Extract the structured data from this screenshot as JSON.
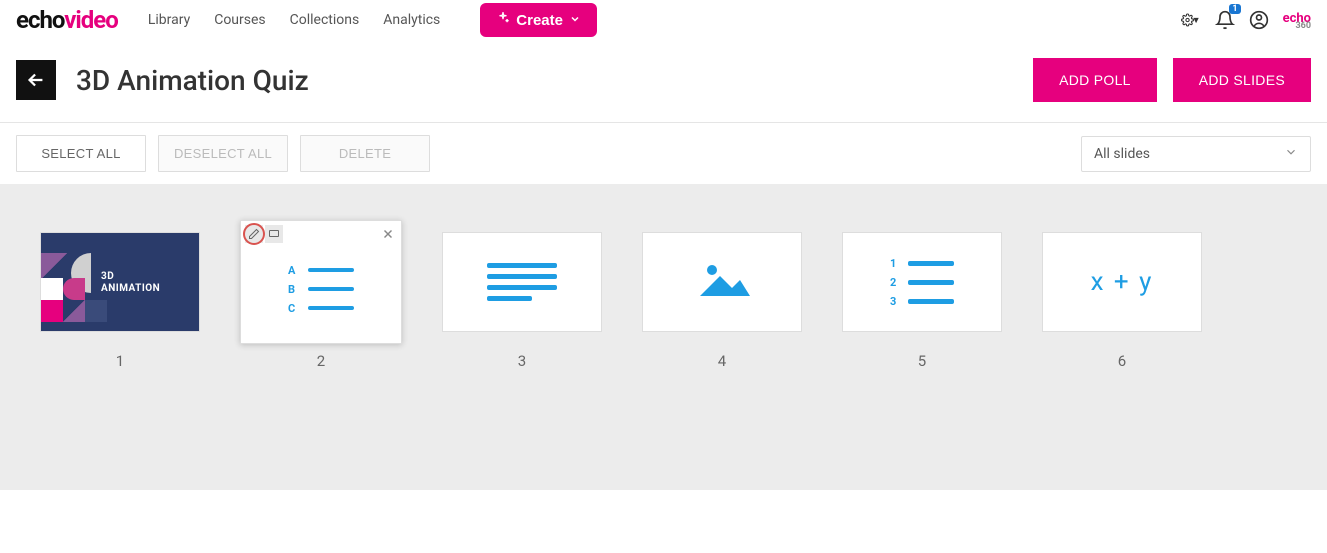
{
  "brand": {
    "part1": "echo",
    "part2": "video"
  },
  "nav": {
    "library": "Library",
    "courses": "Courses",
    "collections": "Collections",
    "analytics": "Analytics",
    "create": "Create"
  },
  "header_icons": {
    "settings": "settings-icon",
    "notifications_badge": "1",
    "account": "account-icon",
    "echo360_brand": "echo",
    "echo360_sub": "360"
  },
  "page": {
    "title": "3D Animation Quiz",
    "add_poll": "ADD POLL",
    "add_slides": "ADD SLIDES"
  },
  "toolbar": {
    "select_all": "SELECT ALL",
    "deselect_all": "DESELECT ALL",
    "delete": "DELETE",
    "filter_selected": "All slides"
  },
  "slides": {
    "s1": {
      "number": "1",
      "title_line1": "3D",
      "title_line2": "ANIMATION"
    },
    "s2": {
      "number": "2",
      "options": {
        "a": "A",
        "b": "B",
        "c": "C"
      }
    },
    "s3": {
      "number": "3"
    },
    "s4": {
      "number": "4"
    },
    "s5": {
      "number": "5",
      "nums": {
        "n1": "1",
        "n2": "2",
        "n3": "3"
      }
    },
    "s6": {
      "number": "6",
      "formula": "x + y"
    }
  }
}
